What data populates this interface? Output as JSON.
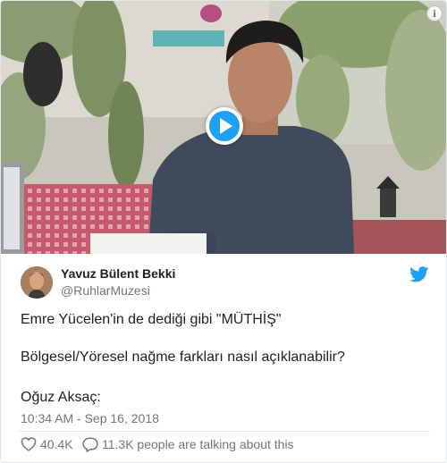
{
  "media": {
    "kind": "video",
    "play_icon": "play-icon",
    "info_icon": "info-icon",
    "info_glyph": "i",
    "accent": "#1da1f2"
  },
  "tweet": {
    "author_name": "Yavuz Bülent Bekki",
    "author_handle": "@RuhlarMuzesi",
    "lines": [
      "Emre Yücelen'in de dediği gibi \"MÜTHİŞ\"",
      "Bölgesel/Yöresel nağme farkları nasıl açıklanabilir?",
      "Oğuz Aksaç:"
    ],
    "timestamp": "10:34 AM - Sep 16, 2018",
    "likes": "40.4K",
    "replies_text": "11.3K people are talking about this"
  },
  "colors": {
    "text": "#1c2022",
    "muted": "#697882",
    "twitter_blue": "#1da1f2",
    "border": "#e1e8ed"
  }
}
